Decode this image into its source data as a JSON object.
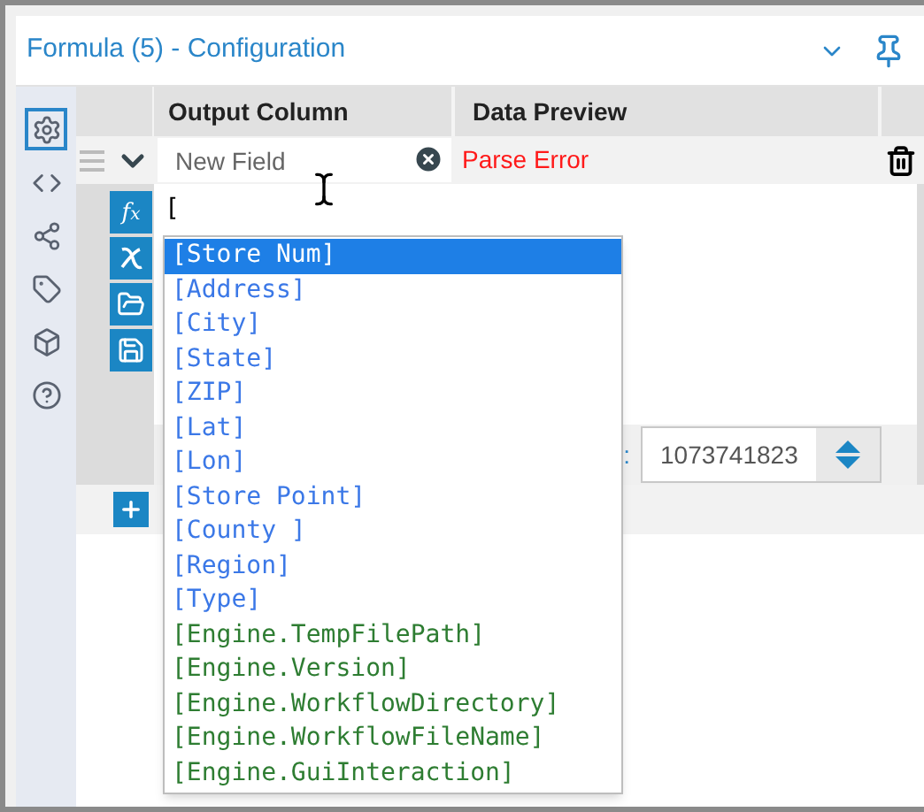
{
  "window": {
    "title": "Formula (5) - Configuration"
  },
  "sidebar": {
    "items": [
      {
        "kind": "settings",
        "selected": true
      },
      {
        "kind": "code",
        "selected": false
      },
      {
        "kind": "share",
        "selected": false
      },
      {
        "kind": "tag",
        "selected": false
      },
      {
        "kind": "package",
        "selected": false
      },
      {
        "kind": "help",
        "selected": false
      }
    ]
  },
  "table": {
    "columns": [
      "Output Column",
      "Data Preview"
    ],
    "row": {
      "placeholder": "New Field",
      "preview": "Parse Error"
    }
  },
  "expression": {
    "value": "[",
    "tools": [
      {
        "kind": "fx"
      },
      {
        "kind": "variable"
      },
      {
        "kind": "open"
      },
      {
        "kind": "save"
      }
    ]
  },
  "size": {
    "label": ":",
    "value": "1073741823"
  },
  "autocomplete": [
    {
      "label": "[Store Num]",
      "kind": "field",
      "selected": true
    },
    {
      "label": "[Address]",
      "kind": "field",
      "selected": false
    },
    {
      "label": "[City]",
      "kind": "field",
      "selected": false
    },
    {
      "label": "[State]",
      "kind": "field",
      "selected": false
    },
    {
      "label": "[ZIP]",
      "kind": "field",
      "selected": false
    },
    {
      "label": "[Lat]",
      "kind": "field",
      "selected": false
    },
    {
      "label": "[Lon]",
      "kind": "field",
      "selected": false
    },
    {
      "label": "[Store Point]",
      "kind": "field",
      "selected": false
    },
    {
      "label": "[County ]",
      "kind": "field",
      "selected": false
    },
    {
      "label": "[Region]",
      "kind": "field",
      "selected": false
    },
    {
      "label": "[Type]",
      "kind": "field",
      "selected": false
    },
    {
      "label": "[Engine.TempFilePath]",
      "kind": "constant",
      "selected": false
    },
    {
      "label": "[Engine.Version]",
      "kind": "constant",
      "selected": false
    },
    {
      "label": "[Engine.WorkflowDirectory]",
      "kind": "constant",
      "selected": false
    },
    {
      "label": "[Engine.WorkflowFileName]",
      "kind": "constant",
      "selected": false
    },
    {
      "label": "[Engine.GuiInteraction]",
      "kind": "constant",
      "selected": false
    }
  ]
}
